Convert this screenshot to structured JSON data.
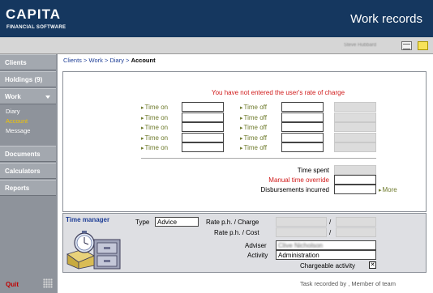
{
  "header": {
    "logo_main": "CAPITA",
    "logo_sub": "FINANCIAL SOFTWARE",
    "title": "Work records"
  },
  "toolbar": {
    "user_name": "Steve Hubbard",
    "icons": [
      "grid-icon",
      "note-icon"
    ]
  },
  "sidebar": {
    "items": [
      {
        "label": "Clients"
      },
      {
        "label": "Holdings",
        "count": "(9)"
      },
      {
        "label": "Work"
      },
      {
        "label": "Documents"
      },
      {
        "label": "Calculators"
      },
      {
        "label": "Reports"
      }
    ],
    "work_submenu": [
      {
        "label": "Diary",
        "active": false
      },
      {
        "label": "Account",
        "active": true
      },
      {
        "label": "Message",
        "active": false
      }
    ],
    "quit_label": "Quit"
  },
  "breadcrumb": {
    "items": [
      "Clients",
      "Work",
      "Diary"
    ],
    "separator": ">",
    "current": "Account"
  },
  "form": {
    "warning": "You have not entered the user's rate of charge",
    "time_on_label": "Time on",
    "time_off_label": "Time off",
    "rows": [
      {
        "time_on": "",
        "time_off": ""
      },
      {
        "time_on": "",
        "time_off": ""
      },
      {
        "time_on": "",
        "time_off": ""
      },
      {
        "time_on": "",
        "time_off": ""
      },
      {
        "time_on": "",
        "time_off": ""
      }
    ],
    "time_spent_label": "Time spent",
    "manual_override_label": "Manual time override",
    "disbursements_label": "Disbursements incurred",
    "more_label": "More"
  },
  "time_manager": {
    "title": "Time manager",
    "type_label": "Type",
    "type_value": "Advice",
    "rate_charge_label": "Rate p.h. / Charge",
    "rate_cost_label": "Rate p.h. / Cost",
    "slash": "/",
    "adviser_label": "Adviser",
    "adviser_value": "Clive Nicholson",
    "activity_label": "Activity",
    "activity_value": "Administration",
    "chargeable_label": "Chargeable activity",
    "chargeable_checked": true,
    "checkbox_mark": "✕"
  },
  "status": {
    "text": "Task recorded by , Member of  team"
  },
  "colors": {
    "header_bg": "#15375f",
    "sidebar_bg": "#8e939b",
    "accent_link": "#1e3e96",
    "warning": "#d01a1a",
    "label_olive": "#6e7a2c",
    "active_submenu": "#f2c400"
  }
}
